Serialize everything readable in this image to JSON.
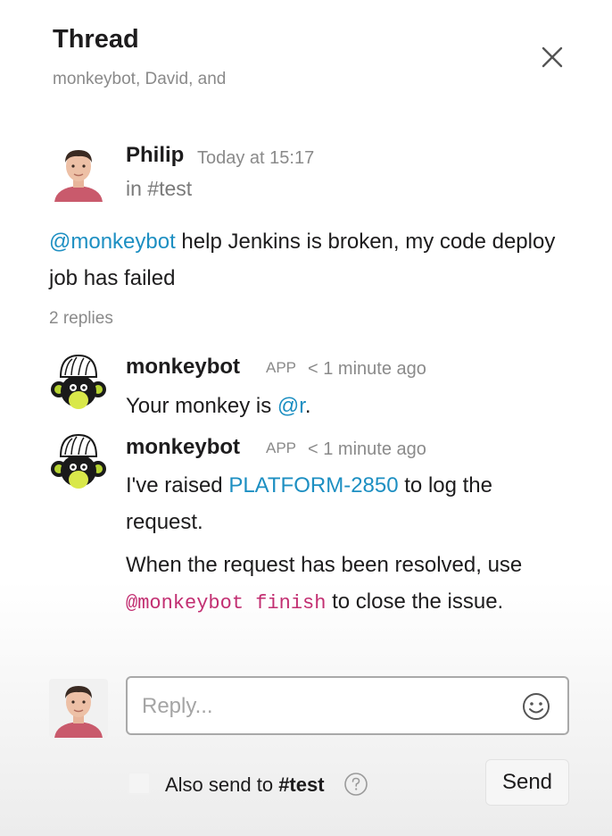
{
  "header": {
    "title": "Thread",
    "participants": "monkeybot, David, and"
  },
  "parent_message": {
    "author": "Philip",
    "timestamp": "Today at 15:17",
    "channel": "in #test",
    "mention": "@monkeybot",
    "text": " help Jenkins is broken, my code deploy job has failed",
    "replies_count": "2 replies"
  },
  "replies": [
    {
      "author": "monkeybot",
      "badge": "APP",
      "time": "< 1 minute ago",
      "text_prefix": "Your monkey is ",
      "mention": "@r",
      "text_suffix": "."
    },
    {
      "author": "monkeybot",
      "badge": "APP",
      "time": "< 1 minute ago",
      "text_prefix": "I've raised ",
      "link": "PLATFORM-2850",
      "text_suffix": " to log the request.",
      "text2_prefix": "When the request has been resolved, use ",
      "code": "@monkeybot finish",
      "text2_suffix": " to close the issue."
    }
  ],
  "composer": {
    "placeholder": "Reply...",
    "also_send_prefix": "Also send to ",
    "also_send_channel": "#test",
    "send_label": "Send"
  },
  "colors": {
    "link": "#1d8fc2",
    "code": "#c22e71",
    "muted": "#8a8a8a"
  },
  "icons": {
    "close": "close-icon",
    "emoji": "emoji-icon",
    "help": "help-icon"
  }
}
